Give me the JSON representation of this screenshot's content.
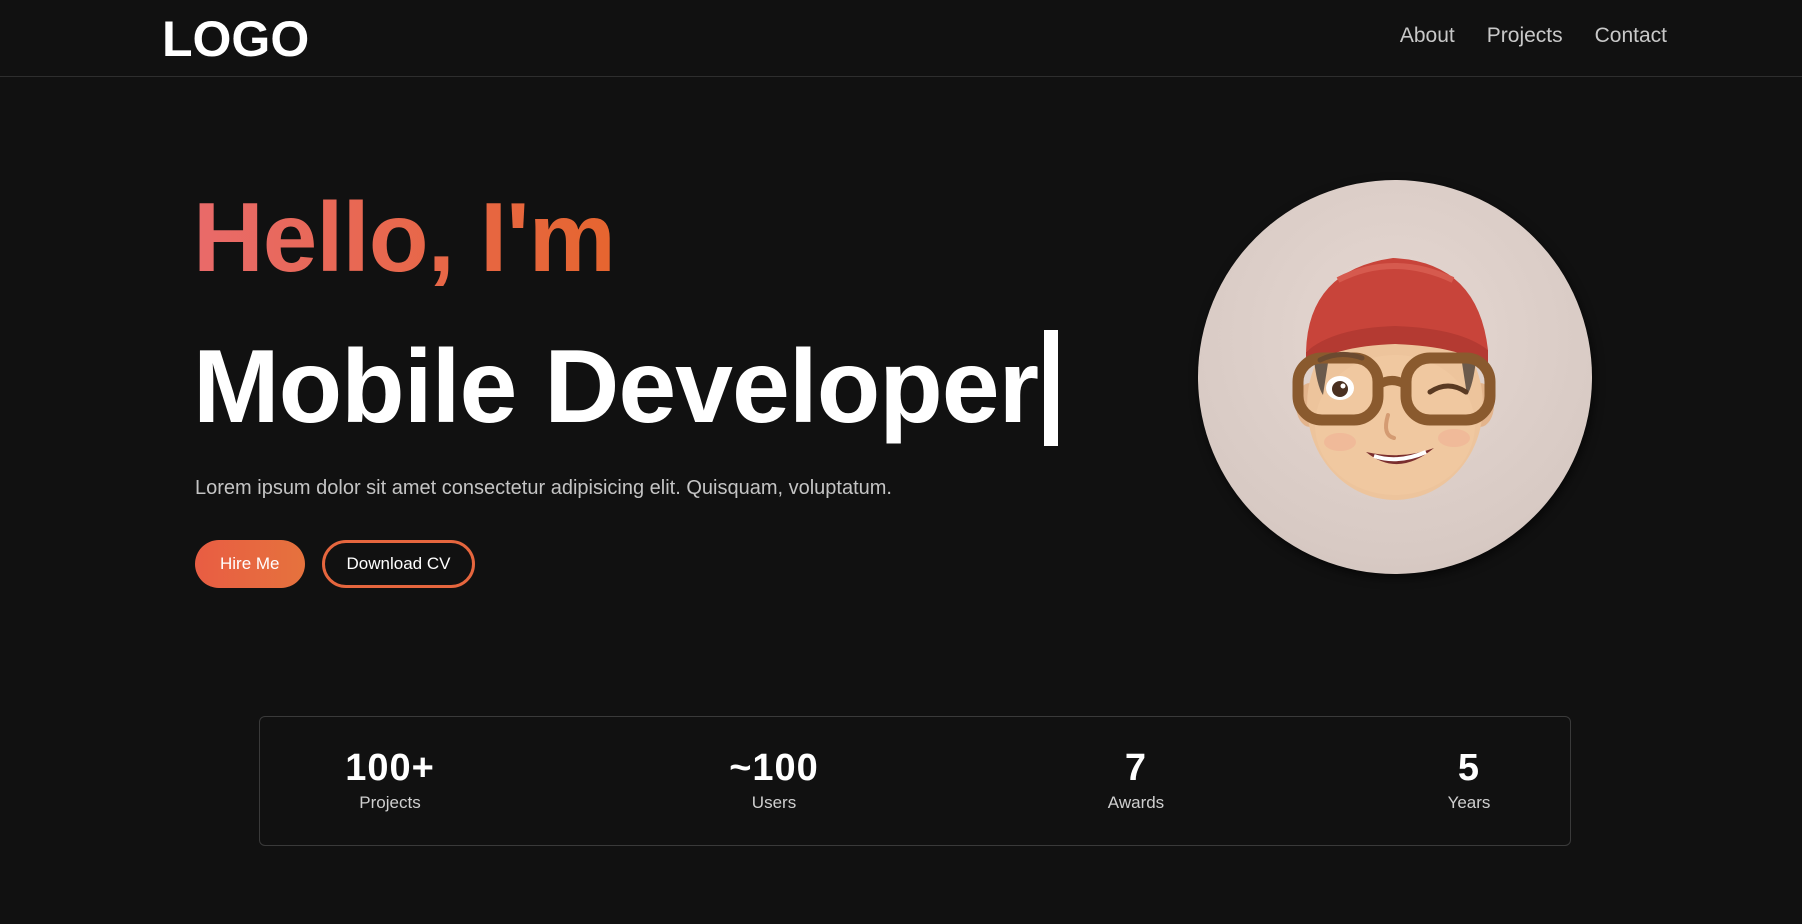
{
  "nav": {
    "logo": "LOGO",
    "links": [
      "About",
      "Projects",
      "Contact"
    ]
  },
  "hero": {
    "greeting": "Hello, I'm",
    "role": "Mobile Developer",
    "subtitle": "Lorem ipsum dolor sit amet consectetur adipisicing elit. Quisquam, voluptatum.",
    "primary_button": "Hire Me",
    "secondary_button": "Download CV",
    "accent_color": "#e6663e",
    "avatar_icon": "memoji-avatar-icon"
  },
  "stats": [
    {
      "value": "100+",
      "label": "Projects"
    },
    {
      "value": "~100",
      "label": "Users"
    },
    {
      "value": "7",
      "label": "Awards"
    },
    {
      "value": "5",
      "label": "Years"
    }
  ]
}
